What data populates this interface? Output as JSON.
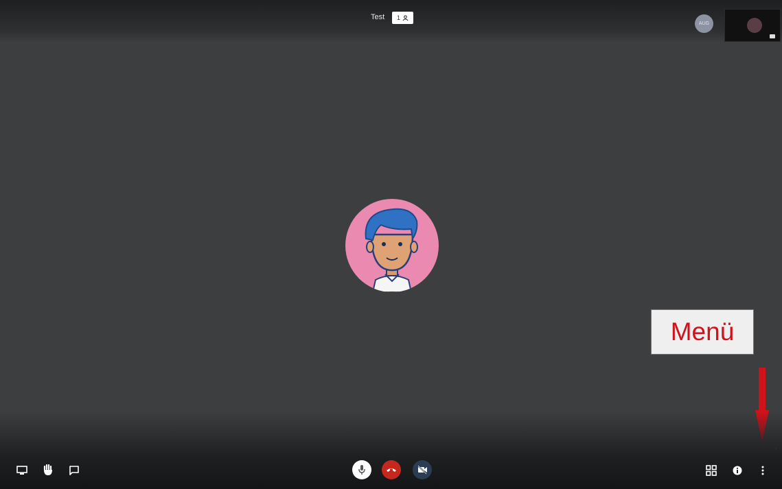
{
  "header": {
    "meeting_title": "Test",
    "participant_count": "1"
  },
  "top_avatar": {
    "initials": "AUG"
  },
  "annotation": {
    "label": "Menü",
    "color": "#d0121b"
  },
  "toolbar": {
    "left": [
      "screen-share-icon",
      "raise-hand-icon",
      "chat-icon"
    ],
    "center": [
      "microphone-icon",
      "hangup-icon",
      "camera-off-icon"
    ],
    "right": [
      "tile-view-icon",
      "info-icon",
      "more-options-icon"
    ]
  },
  "colors": {
    "background": "#3d3e40",
    "hangup": "#c6281e",
    "avatar_bg": "#ea8ab0"
  }
}
